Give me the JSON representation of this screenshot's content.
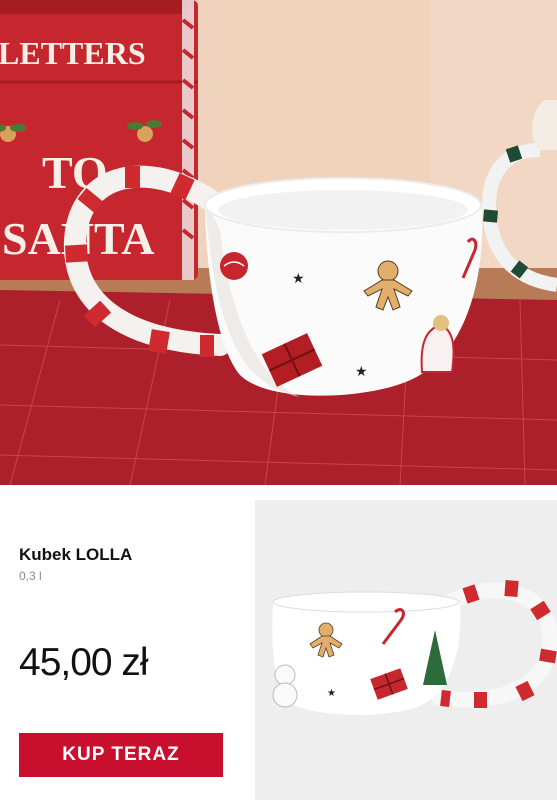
{
  "hero": {
    "sign_text_top": "LETTERS",
    "sign_text_to": "TO",
    "sign_text_santa": "SANTA"
  },
  "product": {
    "name": "Kubek LOLLA",
    "volume": "0,3 l",
    "price": "45,00 zł",
    "buy_label": "KUP TERAZ"
  },
  "colors": {
    "accent": "#c8102e",
    "photo_bg": "#eeeeee"
  }
}
